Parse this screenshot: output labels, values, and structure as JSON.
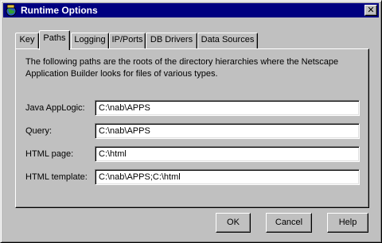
{
  "window": {
    "title": "Runtime Options",
    "close_glyph": "✕"
  },
  "tabs": [
    {
      "label": "Key",
      "active": false
    },
    {
      "label": "Paths",
      "active": true
    },
    {
      "label": "Logging",
      "active": false
    },
    {
      "label": "IP/Ports",
      "active": false
    },
    {
      "label": "DB Drivers",
      "active": false
    },
    {
      "label": "Data Sources",
      "active": false
    }
  ],
  "paths_tab": {
    "description": "The following paths are the roots of the directory hierarchies where the Netscape Application Builder looks for files of various types.",
    "fields": [
      {
        "label": "Java AppLogic:",
        "value": "C:\\nab\\APPS"
      },
      {
        "label": "Query:",
        "value": "C:\\nab\\APPS"
      },
      {
        "label": "HTML page:",
        "value": "C:\\html"
      },
      {
        "label": "HTML template:",
        "value": "C:\\nab\\APPS;C:\\html"
      }
    ]
  },
  "buttons": {
    "ok": "OK",
    "cancel": "Cancel",
    "help": "Help"
  },
  "colors": {
    "titlebar": "#000080",
    "face": "#c0c0c0"
  },
  "icons": {
    "title": "app-globe-icon",
    "close": "close-icon"
  }
}
